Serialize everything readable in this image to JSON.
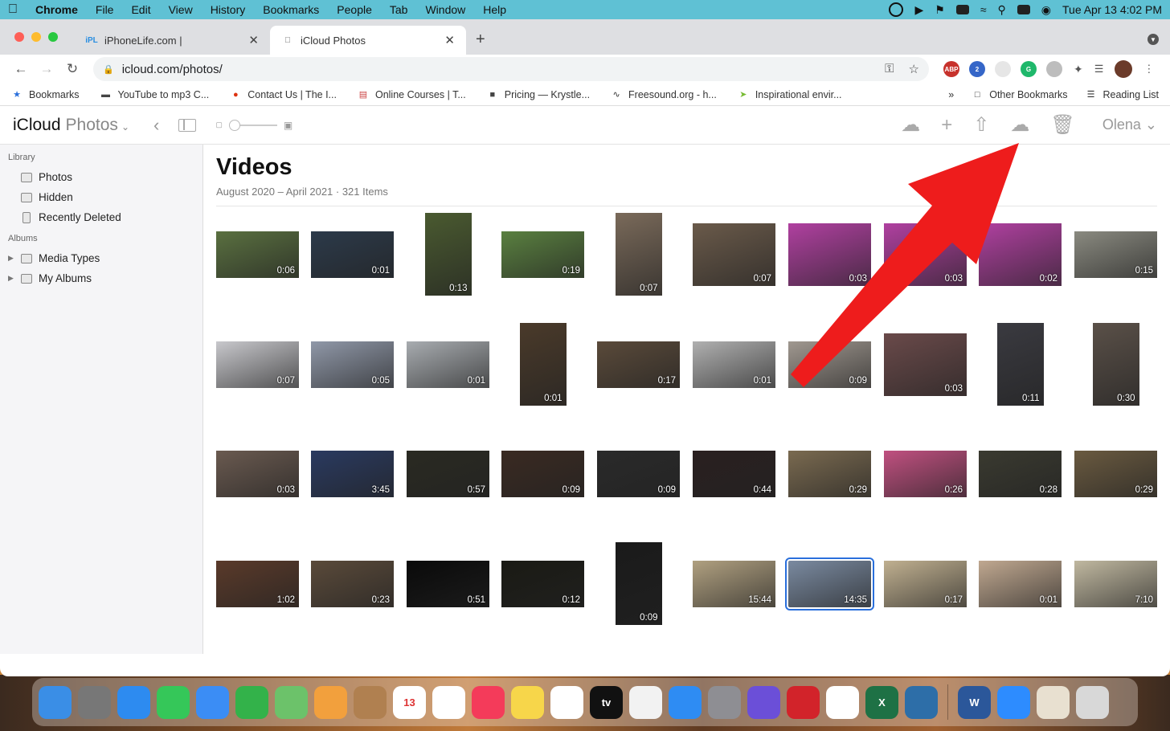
{
  "menubar": {
    "app": "Chrome",
    "items": [
      "File",
      "Edit",
      "View",
      "History",
      "Bookmarks",
      "People",
      "Tab",
      "Window",
      "Help"
    ],
    "datetime": "Tue Apr 13  4:02 PM"
  },
  "tabs": [
    {
      "title": "iPhoneLife.com |",
      "favicon": "iPL"
    },
    {
      "title": "iCloud Photos",
      "favicon": ""
    }
  ],
  "address": {
    "url": "icloud.com/photos/"
  },
  "extensions": [
    {
      "label": "ABP",
      "color": "#c7322c"
    },
    {
      "label": "2",
      "color": "#3566c8"
    },
    {
      "label": "",
      "color": "#e6e6e6"
    },
    {
      "label": "G",
      "color": "#1fb86b"
    },
    {
      "label": "",
      "color": "#bdbdbd"
    }
  ],
  "bookmarks": {
    "items": [
      "Bookmarks",
      "YouTube to mp3 C...",
      "Contact Us | The I...",
      "Online Courses | T...",
      "Pricing — Krystle...",
      "Freesound.org - h...",
      "Inspirational envir..."
    ],
    "overflow": "»",
    "other": "Other Bookmarks",
    "reading": "Reading List"
  },
  "app": {
    "brand": "iCloud",
    "section": "Photos",
    "user": "Olena"
  },
  "sidebar": {
    "library_label": "Library",
    "library": [
      "Photos",
      "Hidden",
      "Recently Deleted"
    ],
    "albums_label": "Albums",
    "albums": [
      "Media Types",
      "My Albums"
    ]
  },
  "page": {
    "title": "Videos",
    "subtitle": "August 2020 – April 2021  ·  321 Items"
  },
  "videos": [
    [
      "0:06",
      "0:01",
      "0:13",
      "0:19",
      "0:07",
      "0:07",
      "0:03",
      "0:03",
      "0:02",
      "0:15"
    ],
    [
      "0:07",
      "0:05",
      "0:01",
      "0:01",
      "0:17",
      "0:01",
      "0:09",
      "0:03",
      "0:11",
      "0:30"
    ],
    [
      "0:03",
      "3:45",
      "0:57",
      "0:09",
      "0:09",
      "0:44",
      "0:29",
      "0:26",
      "0:28",
      "0:29"
    ],
    [
      "1:02",
      "0:23",
      "0:51",
      "0:12",
      "0:09",
      "15:44",
      "14:35",
      "0:17",
      "0:01",
      "7:10"
    ]
  ],
  "selected": {
    "row": 3,
    "col": 6
  },
  "dock": [
    {
      "name": "finder",
      "color": "#3a8ee6"
    },
    {
      "name": "launchpad",
      "color": "#777"
    },
    {
      "name": "safari",
      "color": "#2d8bf0"
    },
    {
      "name": "messages",
      "color": "#35c759"
    },
    {
      "name": "mail",
      "color": "#3b8df5"
    },
    {
      "name": "facetime",
      "color": "#33b24a"
    },
    {
      "name": "maps",
      "color": "#6cc26a"
    },
    {
      "name": "photos",
      "color": "#f2a03d"
    },
    {
      "name": "contacts",
      "color": "#b08050"
    },
    {
      "name": "calendar",
      "color": "#ffffff",
      "text": "13"
    },
    {
      "name": "reminders",
      "color": "#ffffff"
    },
    {
      "name": "music",
      "color": "#f43b5a"
    },
    {
      "name": "notes",
      "color": "#f7d64a"
    },
    {
      "name": "chrome",
      "color": "#ffffff"
    },
    {
      "name": "appletv",
      "color": "#111111",
      "text": "tv"
    },
    {
      "name": "news",
      "color": "#f2f2f2"
    },
    {
      "name": "appstore",
      "color": "#2e8cf3"
    },
    {
      "name": "settings",
      "color": "#8e8e93"
    },
    {
      "name": "imovie",
      "color": "#6b4fd8"
    },
    {
      "name": "kiss",
      "color": "#d2232a"
    },
    {
      "name": "slack",
      "color": "#ffffff"
    },
    {
      "name": "excel",
      "color": "#1e7145",
      "text": "X"
    },
    {
      "name": "quicktime",
      "color": "#2d6ea8"
    },
    {
      "name": "word",
      "color": "#2b579a",
      "text": "W"
    },
    {
      "name": "zoom",
      "color": "#2d8cff"
    },
    {
      "name": "bunny",
      "color": "#e8e0d0"
    },
    {
      "name": "trash",
      "color": "#d8d8d8"
    }
  ]
}
